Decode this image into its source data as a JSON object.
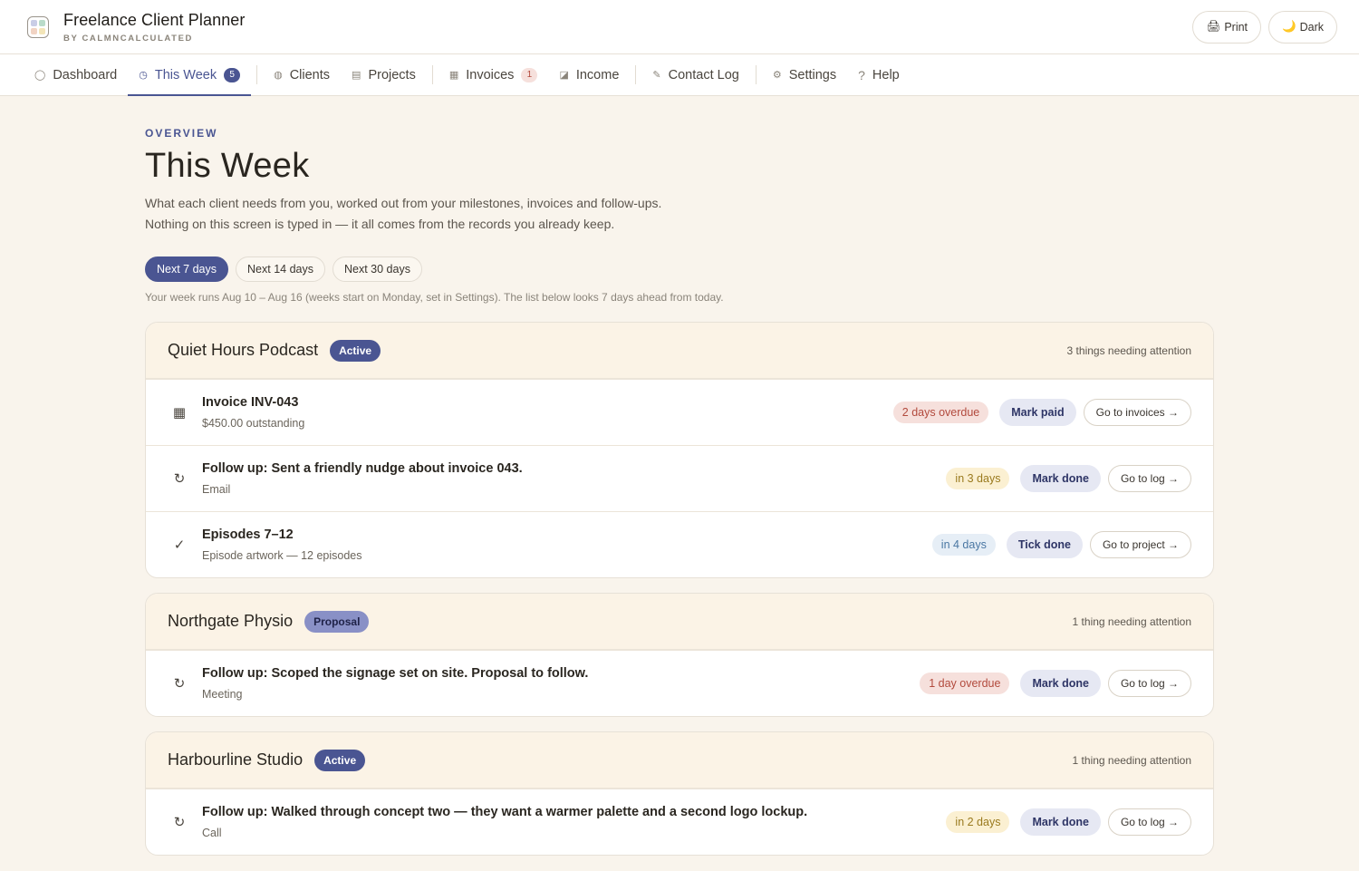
{
  "header": {
    "title": "Freelance Client Planner",
    "subtitle": "BY CALMNCALCULATED",
    "print_label": "Print",
    "dark_label": "Dark",
    "print_icon": "🖨",
    "dark_icon": "🌙"
  },
  "nav": {
    "dashboard": {
      "icon": "◯",
      "label": "Dashboard"
    },
    "this_week": {
      "icon": "◷",
      "label": "This Week",
      "count": "5"
    },
    "clients": {
      "icon": "◍",
      "label": "Clients"
    },
    "projects": {
      "icon": "▤",
      "label": "Projects"
    },
    "invoices": {
      "icon": "▦",
      "label": "Invoices",
      "count": "1"
    },
    "income": {
      "icon": "◪",
      "label": "Income"
    },
    "contact_log": {
      "icon": "✎",
      "label": "Contact Log"
    },
    "settings": {
      "icon": "⚙",
      "label": "Settings"
    },
    "help": {
      "icon": "?",
      "label": "Help"
    }
  },
  "page": {
    "eyebrow": "OVERVIEW",
    "title": "This Week",
    "desc_line1": "What each client needs from you, worked out from your milestones, invoices and follow-ups.",
    "desc_line2": "Nothing on this screen is typed in — it all comes from the records you already keep.",
    "ranges": [
      "Next 7 days",
      "Next 14 days",
      "Next 30 days"
    ],
    "week_note": "Your week runs Aug 10 – Aug 16 (weeks start on Monday, set in Settings). The list below looks 7 days ahead from today."
  },
  "clients": [
    {
      "name": "Quiet Hours Podcast",
      "status": "Active",
      "attention": "3 things needing attention",
      "items": [
        {
          "icon": "▦",
          "title": "Invoice INV-043",
          "sub": "$450.00 outstanding",
          "due": "2 days overdue",
          "action": "Mark paid",
          "go": "Go to invoices →"
        },
        {
          "icon": "↻",
          "title": "Follow up: Sent a friendly nudge about invoice 043.",
          "sub": "Email",
          "due": "in 3 days",
          "action": "Mark done",
          "go": "Go to log →"
        },
        {
          "icon": "✓",
          "title": "Episodes 7–12",
          "sub": "Episode artwork — 12 episodes",
          "due": "in 4 days",
          "action": "Tick done",
          "go": "Go to project →"
        }
      ]
    },
    {
      "name": "Northgate Physio",
      "status": "Proposal",
      "attention": "1 thing needing attention",
      "items": [
        {
          "icon": "↻",
          "title": "Follow up: Scoped the signage set on site. Proposal to follow.",
          "sub": "Meeting",
          "due": "1 day overdue",
          "action": "Mark done",
          "go": "Go to log →"
        }
      ]
    },
    {
      "name": "Harbourline Studio",
      "status": "Active",
      "attention": "1 thing needing attention",
      "items": [
        {
          "icon": "↻",
          "title": "Follow up: Walked through concept two — they want a warmer palette and a second logo lockup.",
          "sub": "Call",
          "due": "in 2 days",
          "action": "Mark done",
          "go": "Go to log →"
        }
      ]
    }
  ],
  "colors": {
    "accent": "#4a5592",
    "overdue": "#b24a3d",
    "soon": "#9a7a1e",
    "later": "#4a77a3",
    "background": "#f9f4ec"
  }
}
